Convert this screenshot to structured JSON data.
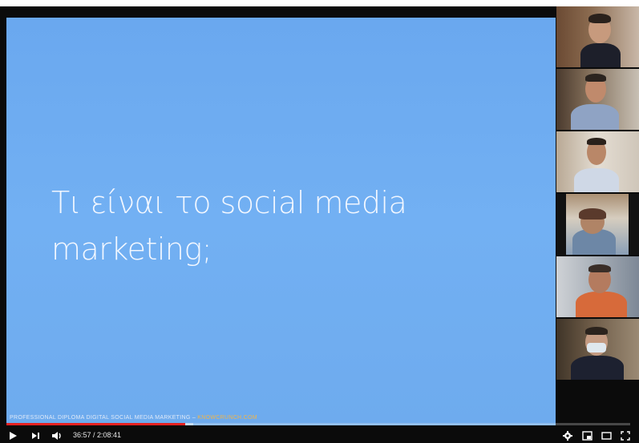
{
  "slide": {
    "title_line1": "Τι είναι το social media",
    "title_line2": "marketing;",
    "footer_text": "PROFESSIONAL DIPLOMA DIGITAL SOCIAL MEDIA MARKETING – ",
    "footer_url": "KNOWCRUNCH.COM"
  },
  "player": {
    "current_time": "36:57",
    "duration": "2:08:41",
    "time_label": "36:57 / 2:08:41",
    "progress_fraction": 0.287,
    "buffered_fraction": 0.3,
    "progress_color": "#e52222"
  },
  "controls": {
    "play": "play-icon",
    "next": "next-icon",
    "volume": "volume-icon",
    "settings": "gear-icon",
    "miniplayer": "miniplayer-icon",
    "theater": "theater-icon",
    "fullscreen": "fullscreen-icon"
  },
  "participants": [
    {
      "name": "participant-1"
    },
    {
      "name": "participant-2"
    },
    {
      "name": "participant-3"
    },
    {
      "name": "participant-4"
    },
    {
      "name": "participant-5"
    },
    {
      "name": "participant-6"
    }
  ],
  "colors": {
    "slide_bg": "#6eabee",
    "player_bg": "#0b0b0b"
  }
}
